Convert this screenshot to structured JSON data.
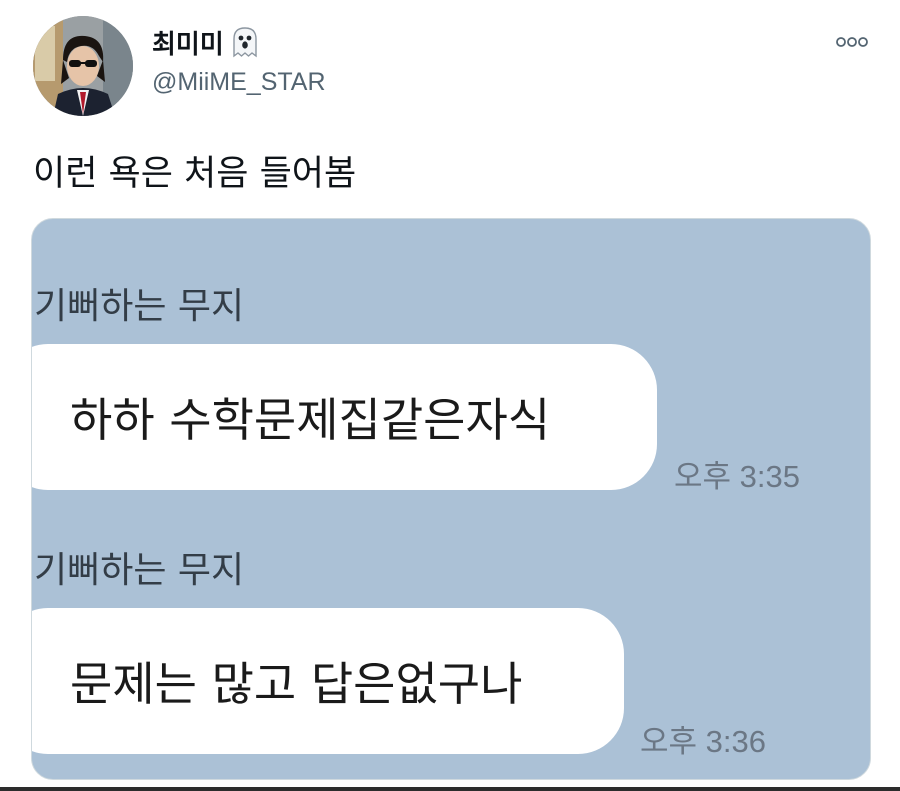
{
  "user": {
    "display_name": "최미미",
    "name_icon": "ghost-emoji-icon",
    "handle": "@MiiME_STAR"
  },
  "tweet": {
    "text": "이런 욕은 처음 들어봄",
    "more_icon": "more-options-icon"
  },
  "chat": {
    "messages": [
      {
        "sender": "기뻐하는 무지",
        "text": "하하 수학문제집같은자식",
        "time": "오후 3:35"
      },
      {
        "sender": "기뻐하는 무지",
        "text": "문제는 많고 답은없구나",
        "time": "오후 3:36"
      }
    ],
    "background_color": "#abc1d6",
    "bubble_color": "#ffffff"
  }
}
